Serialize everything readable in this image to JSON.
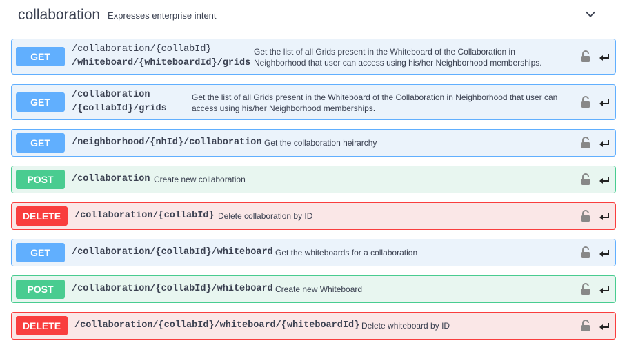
{
  "section": {
    "title": "collaboration",
    "description": "Expresses enterprise intent",
    "toggle_icon": "chevron-down-icon"
  },
  "colors": {
    "get": "#61affe",
    "post": "#49cc90",
    "delete": "#f93e3e"
  },
  "operations": [
    {
      "method": "GET",
      "path_line1": "/collaboration/{collabId}",
      "path_line2": "/whiteboard/{whiteboardId}/grids",
      "summary": "Get the list of all Grids present in the Whiteboard of the Collaboration in Neighborhood that user can access using his/her Neighborhood memberships."
    },
    {
      "method": "GET",
      "path_line1": "/collaboration",
      "path_line2": "/{collabId}/grids",
      "summary": "Get the list of all Grids present in the Whiteboard of the Collaboration in Neighborhood that user can access using his/her Neighborhood memberships."
    },
    {
      "method": "GET",
      "path": "/neighborhood/{nhId}/collaboration",
      "summary": "Get the collaboration heirarchy"
    },
    {
      "method": "POST",
      "path": "/collaboration",
      "summary": "Create new collaboration"
    },
    {
      "method": "DELETE",
      "path": "/collaboration/{collabId}",
      "summary": "Delete collaboration by ID"
    },
    {
      "method": "GET",
      "path": "/collaboration/{collabId}/whiteboard",
      "summary": "Get the whiteboards for a collaboration"
    },
    {
      "method": "POST",
      "path": "/collaboration/{collabId}/whiteboard",
      "summary": "Create new Whiteboard"
    },
    {
      "method": "DELETE",
      "path": "/collaboration/{collabId}/whiteboard/{whiteboardId}",
      "summary": "Delete whiteboard by ID"
    }
  ]
}
